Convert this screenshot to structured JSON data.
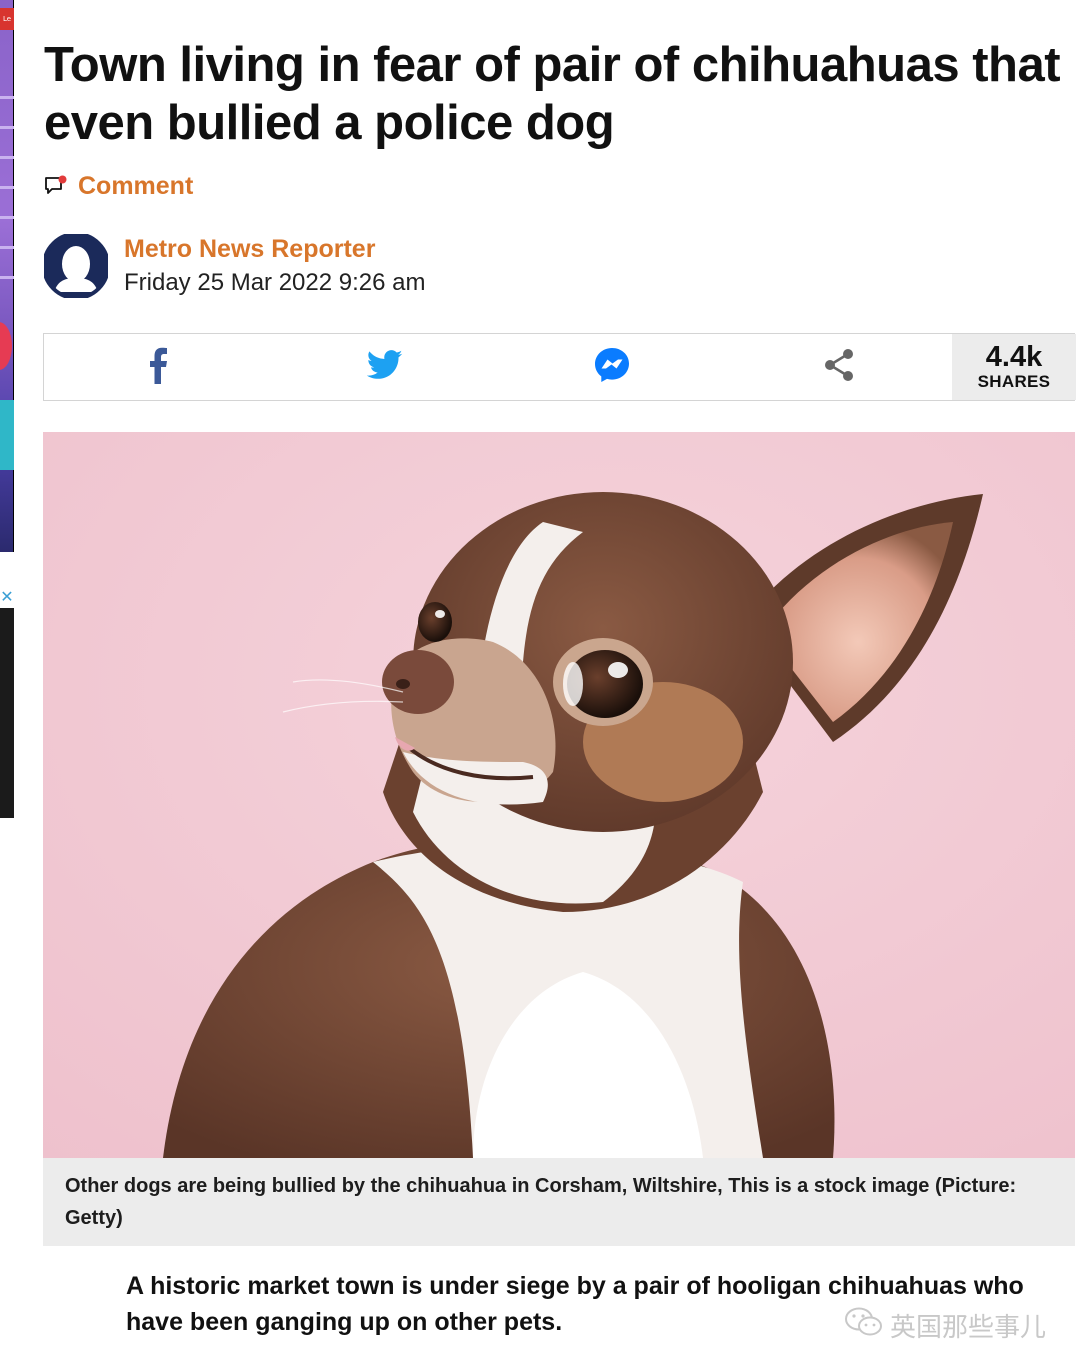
{
  "article": {
    "headline": "Town living in fear of pair of chihuahuas that even bullied a police dog",
    "comment_label": "Comment",
    "author_name": "Metro News Reporter",
    "date": "Friday 25 Mar 2022 9:26 am"
  },
  "share": {
    "buttons": [
      {
        "name": "facebook",
        "icon": "facebook-icon",
        "color": "#3b5998"
      },
      {
        "name": "twitter",
        "icon": "twitter-icon",
        "color": "#1da1f2"
      },
      {
        "name": "messenger",
        "icon": "messenger-icon",
        "color": "#0a7cff"
      },
      {
        "name": "share",
        "icon": "share-icon",
        "color": "#666666"
      }
    ],
    "count": "4.4k",
    "count_label": "SHARES"
  },
  "photo": {
    "caption": "Other dogs are being bullied by the chihuahua in Corsham, Wiltshire, This is a stock image (Picture: Getty)"
  },
  "body": {
    "lede": "A historic market town is under siege by a pair of hooligan chihuahuas who have been ganging up on other pets."
  },
  "watermark": {
    "text": "英国那些事儿"
  },
  "side_window": {
    "tab_label": "Le"
  },
  "colors": {
    "accent": "#d8762b",
    "headline": "#111111",
    "caption_bg": "#ececec",
    "photo_bg": "#f2c9d3"
  }
}
